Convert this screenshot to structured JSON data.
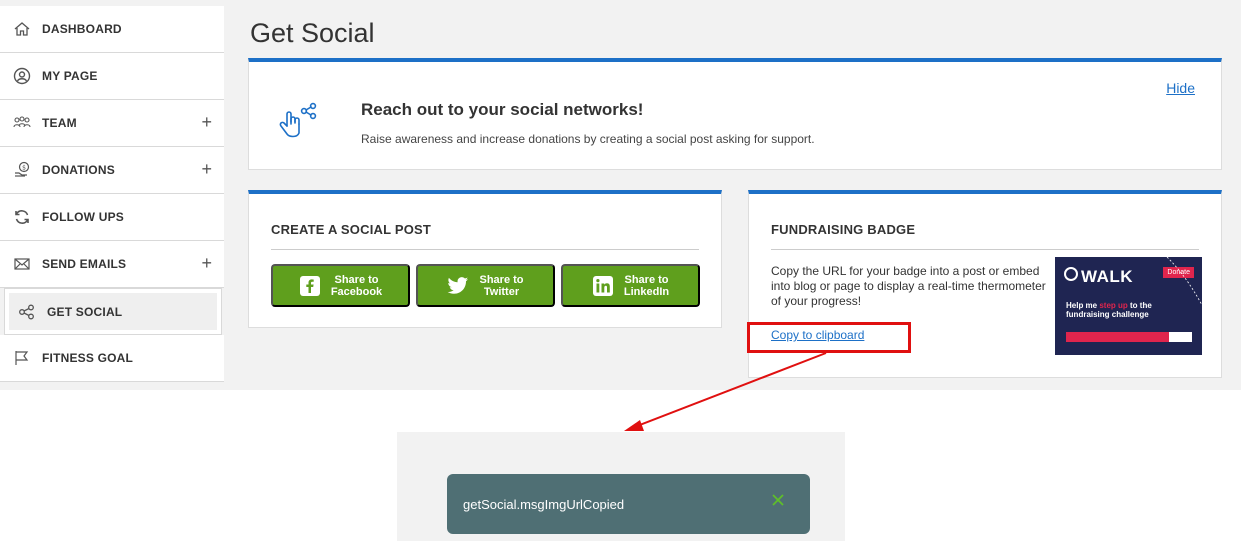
{
  "sidebar": {
    "items": [
      {
        "label": "DASHBOARD",
        "icon": "home-icon",
        "expandable": false
      },
      {
        "label": "MY PAGE",
        "icon": "user-circle-icon",
        "expandable": false
      },
      {
        "label": "TEAM",
        "icon": "team-icon",
        "expandable": true
      },
      {
        "label": "DONATIONS",
        "icon": "donation-icon",
        "expandable": true
      },
      {
        "label": "FOLLOW UPS",
        "icon": "refresh-icon",
        "expandable": false
      },
      {
        "label": "SEND EMAILS",
        "icon": "mail-icon",
        "expandable": true
      },
      {
        "label": "GET SOCIAL",
        "icon": "share-icon",
        "expandable": false,
        "active": true
      },
      {
        "label": "FITNESS GOAL",
        "icon": "flag-icon",
        "expandable": false
      }
    ],
    "plus_symbol": "+"
  },
  "page": {
    "title": "Get Social"
  },
  "banner": {
    "hide_label": "Hide",
    "title": "Reach out to your social networks!",
    "subtitle": "Raise awareness and increase donations by creating a social post asking for support."
  },
  "social_post": {
    "heading": "CREATE A SOCIAL POST",
    "buttons": [
      {
        "line1": "Share to",
        "line2": "Facebook",
        "icon": "facebook-icon"
      },
      {
        "line1": "Share to",
        "line2": "Twitter",
        "icon": "twitter-icon"
      },
      {
        "line1": "Share to",
        "line2": "LinkedIn",
        "icon": "linkedin-icon"
      }
    ]
  },
  "badge": {
    "heading": "FUNDRAISING BADGE",
    "description": "Copy the URL for your badge into a post or embed into blog or page to display a real-time thermometer of your progress!",
    "copy_label": "Copy to clipboard",
    "image": {
      "walk_text": "WALK",
      "donate_text": "Donate",
      "help_prefix": "Help me ",
      "help_highlight": "step up",
      "help_suffix": " to the fundraising challenge",
      "progress_fraction": 0.82
    }
  },
  "toast": {
    "message": "getSocial.msgImgUrlCopied"
  },
  "colors": {
    "accent_blue": "#1d70c7",
    "share_green": "#5f9f1d",
    "toast_bg": "#4f6f74",
    "highlight_red": "#e01010"
  }
}
